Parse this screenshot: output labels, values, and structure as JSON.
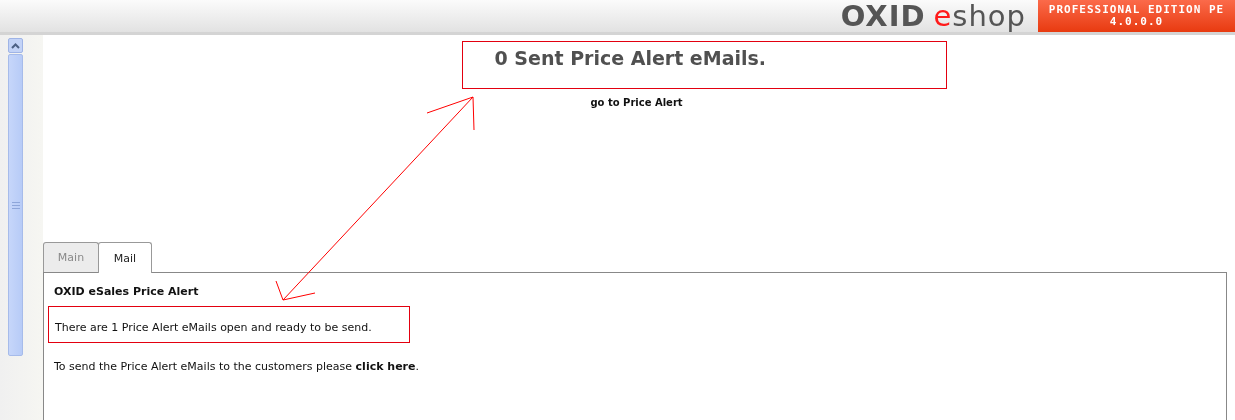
{
  "header": {
    "logo": [
      {
        "text": "OXID",
        "accent": false
      },
      {
        "text": "e",
        "accent": true
      },
      {
        "text": "shop",
        "accent": false
      }
    ],
    "edition": "PROFESSIONAL EDITION PE",
    "version": "4.0.0.0"
  },
  "result": {
    "message": "0 Sent Price Alert eMails.",
    "highlighted": true,
    "link": "go to Price Alert"
  },
  "arrow": true,
  "tabs": [
    {
      "label": "Main",
      "selected": false,
      "disabled": true
    },
    {
      "label": "Mail",
      "selected": true,
      "disabled": false
    }
  ],
  "panel": {
    "title": "OXID eSales Price Alert",
    "status": "There are 1 Price Alert eMails open and ready to be send.",
    "status_highlighted": true,
    "instruction": "To send the Price Alert eMails to the customers please **click here**."
  }
}
